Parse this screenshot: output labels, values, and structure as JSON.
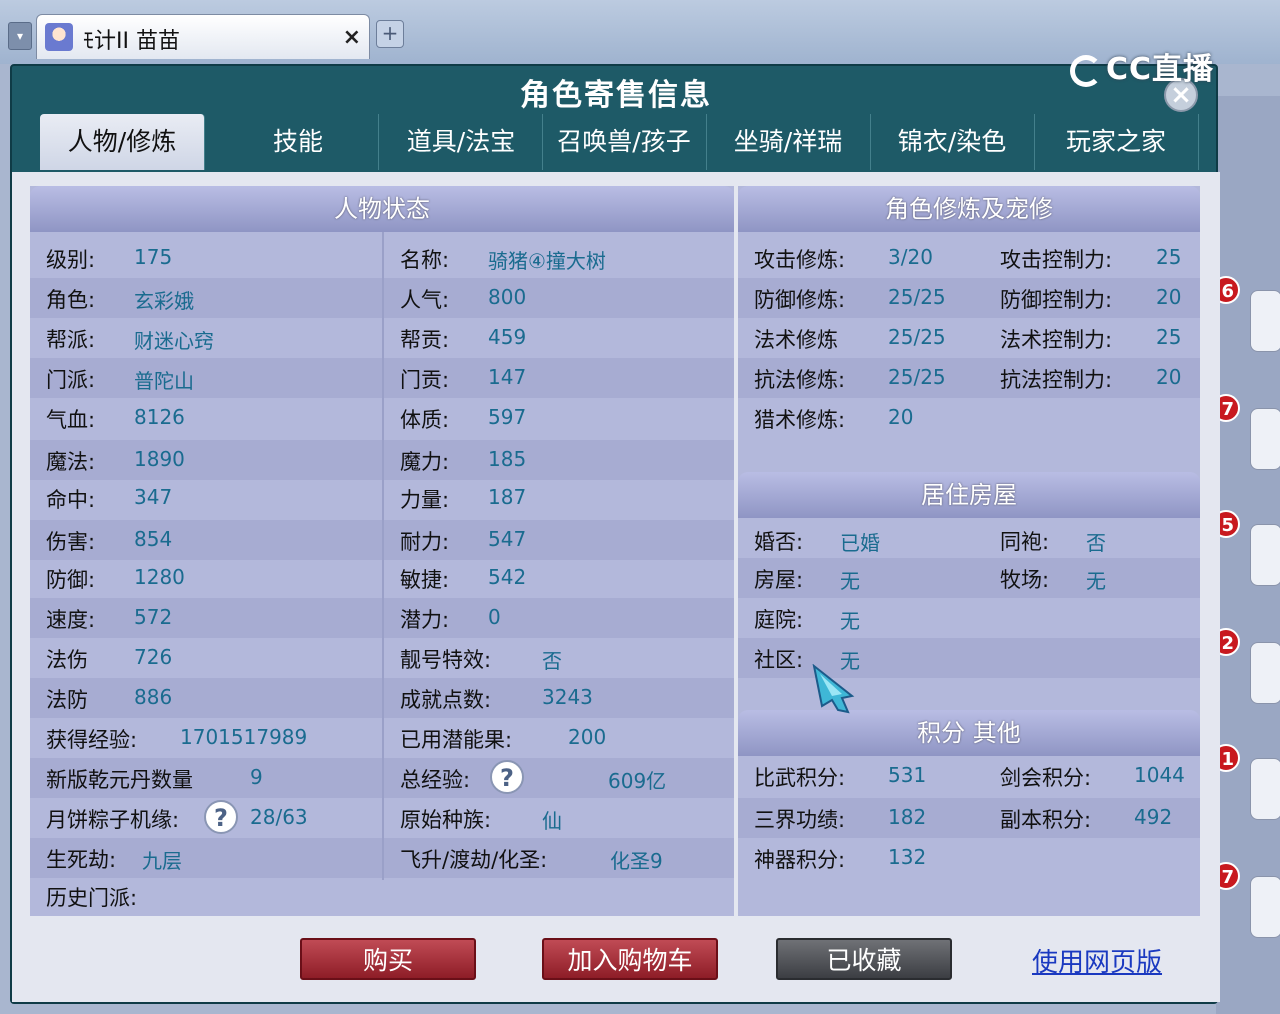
{
  "browser": {
    "tab_title": "ﾓ计II 苗苗",
    "close_glyph": "×",
    "new_tab_glyph": "+",
    "arrow_glyph": "▾"
  },
  "watermark": {
    "text": "CC直播"
  },
  "dialog": {
    "title": "角色寄售信息",
    "close_glyph": "×",
    "tabs": [
      "人物/修炼",
      "技能",
      "道具/法宝",
      "召唤兽/孩子",
      "坐骑/祥瑞",
      "锦衣/染色",
      "玩家之家"
    ],
    "active_tab": 0
  },
  "status": {
    "header": "人物状态",
    "left": [
      {
        "label": "级别:",
        "value": "175"
      },
      {
        "label": "角色:",
        "value": "玄彩娥"
      },
      {
        "label": "帮派:",
        "value": "财迷心窍"
      },
      {
        "label": "门派:",
        "value": "普陀山"
      },
      {
        "label": "气血:",
        "value": "8126"
      },
      {
        "label": "魔法:",
        "value": "1890"
      },
      {
        "label": "命中:",
        "value": "347"
      },
      {
        "label": "伤害:",
        "value": "854"
      },
      {
        "label": "防御:",
        "value": "1280"
      },
      {
        "label": "速度:",
        "value": "572"
      },
      {
        "label": "法伤",
        "value": "726"
      },
      {
        "label": "法防",
        "value": "886"
      },
      {
        "label": "获得经验:",
        "value": "1701517989"
      },
      {
        "label": "新版乾元丹数量",
        "value": "9"
      },
      {
        "label": "月饼粽子机缘:",
        "value": "28/63"
      },
      {
        "label": "生死劫:",
        "value": "九层"
      },
      {
        "label": "历史门派:",
        "value": ""
      }
    ],
    "right": [
      {
        "label": "名称:",
        "value": "骑猪④撞大树"
      },
      {
        "label": "人气:",
        "value": "800"
      },
      {
        "label": "帮贡:",
        "value": "459"
      },
      {
        "label": "门贡:",
        "value": "147"
      },
      {
        "label": "体质:",
        "value": "597"
      },
      {
        "label": "魔力:",
        "value": "185"
      },
      {
        "label": "力量:",
        "value": "187"
      },
      {
        "label": "耐力:",
        "value": "547"
      },
      {
        "label": "敏捷:",
        "value": "542"
      },
      {
        "label": "潜力:",
        "value": "0"
      },
      {
        "label": "靓号特效:",
        "value": "否"
      },
      {
        "label": "成就点数:",
        "value": "3243"
      },
      {
        "label": "已用潜能果:",
        "value": "200"
      },
      {
        "label": "总经验:",
        "value": "609亿"
      },
      {
        "label": "原始种族:",
        "value": "仙"
      },
      {
        "label": "飞升/渡劫/化圣:",
        "value": "化圣9"
      }
    ],
    "help_glyph": "?"
  },
  "cultivation": {
    "header": "角色修炼及宠修",
    "rows": [
      {
        "l1": "攻击修炼:",
        "v1": "3/20",
        "l2": "攻击控制力:",
        "v2": "25"
      },
      {
        "l1": "防御修炼:",
        "v1": "25/25",
        "l2": "防御控制力:",
        "v2": "20"
      },
      {
        "l1": "法术修炼",
        "v1": "25/25",
        "l2": "法术控制力:",
        "v2": "25"
      },
      {
        "l1": "抗法修炼:",
        "v1": "25/25",
        "l2": "抗法控制力:",
        "v2": "20"
      },
      {
        "l1": "猎术修炼:",
        "v1": "20",
        "l2": "",
        "v2": ""
      }
    ]
  },
  "housing": {
    "header": "居住房屋",
    "rows": [
      {
        "l1": "婚否:",
        "v1": "已婚",
        "l2": "同袍:",
        "v2": "否"
      },
      {
        "l1": "房屋:",
        "v1": "无",
        "l2": "牧场:",
        "v2": "无"
      },
      {
        "l1": "庭院:",
        "v1": "无",
        "l2": "",
        "v2": ""
      },
      {
        "l1": "社区:",
        "v1": "无",
        "l2": "",
        "v2": ""
      }
    ]
  },
  "points": {
    "header": "积分 其他",
    "rows": [
      {
        "l1": "比武积分:",
        "v1": "531",
        "l2": "剑会积分:",
        "v2": "1044"
      },
      {
        "l1": "三界功绩:",
        "v1": "182",
        "l2": "副本积分:",
        "v2": "492"
      },
      {
        "l1": "神器积分:",
        "v1": "132",
        "l2": "",
        "v2": ""
      }
    ]
  },
  "actions": {
    "buy": "购买",
    "add_cart": "加入购物车",
    "favorited": "已收藏",
    "web_version": "使用网页版"
  },
  "background_badges": [
    "6",
    "7",
    "5",
    "2",
    "1",
    "7"
  ]
}
